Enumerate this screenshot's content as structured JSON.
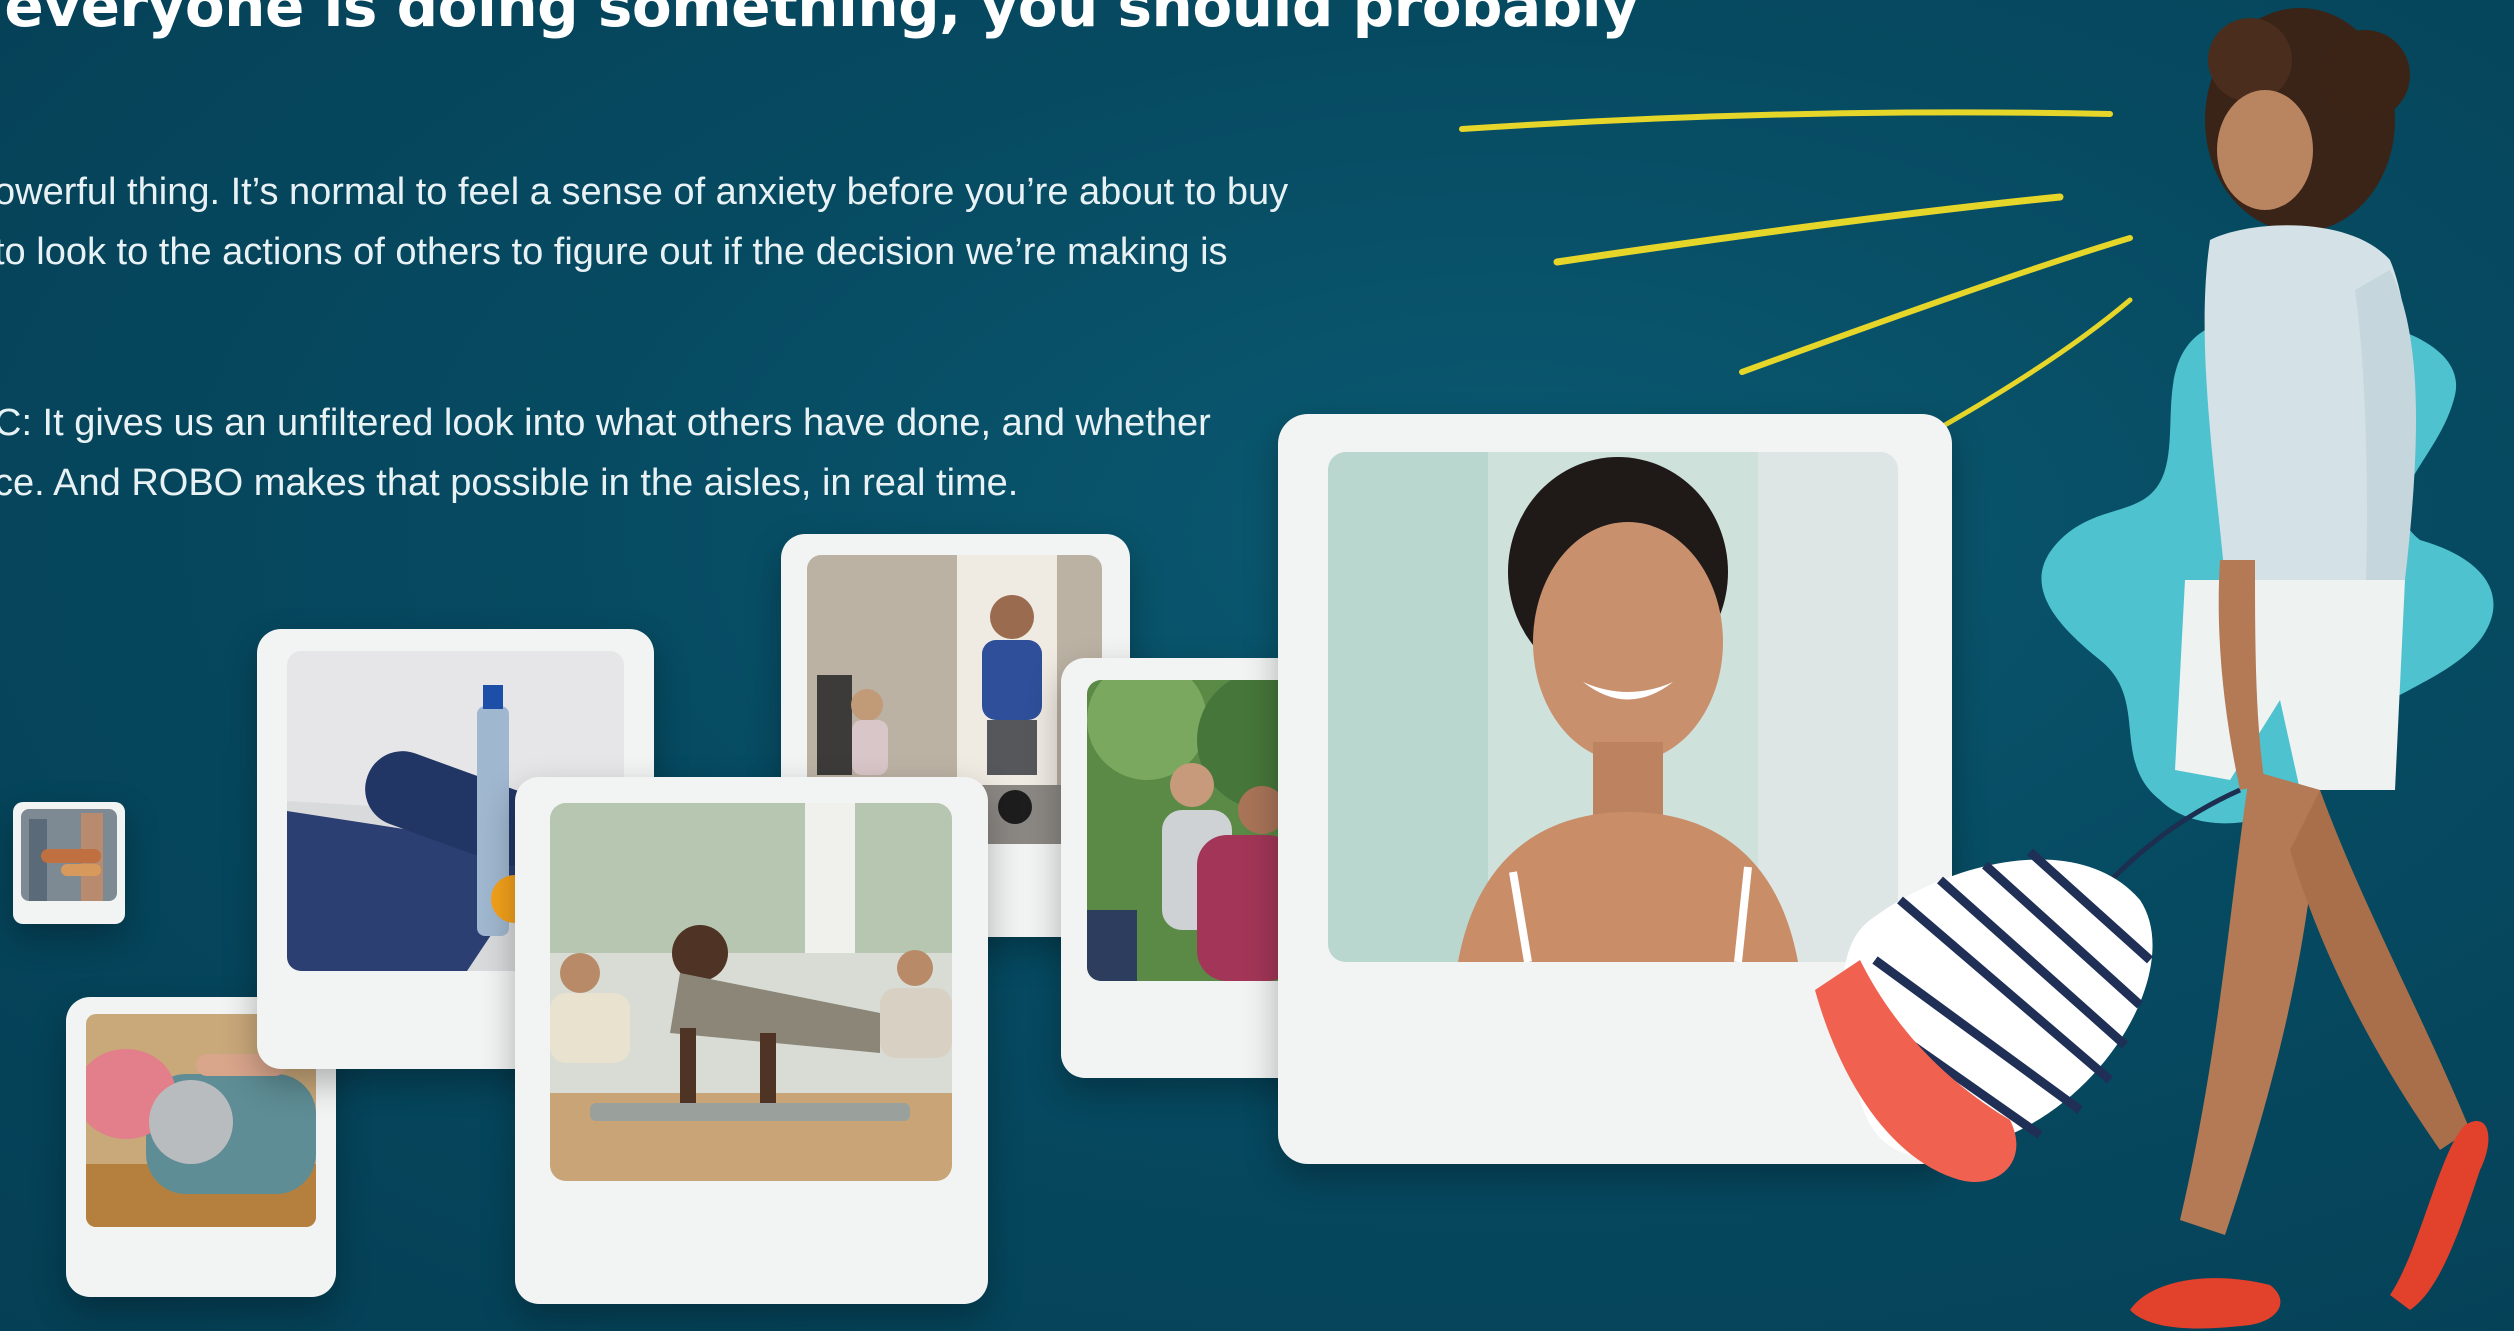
{
  "headline": "f everyone is doing something, you should probably",
  "paragraph_1": {
    "line_1": "owerful thing. It’s normal to feel a sense of anxiety before you’re about to buy",
    "line_2": "to look to the actions of others to figure out if the decision we’re making is"
  },
  "paragraph_2": {
    "line_1": "C: It gives us an unfiltered look into what others have done, and whether",
    "line_2": "ce. And ROBO makes that possible in the aisles, in real time."
  },
  "cards": [
    {
      "subject": "people holding rolled yoga mats"
    },
    {
      "subject": "woman stretching on a mat"
    },
    {
      "subject": "yoga mat with water bottle and orange"
    },
    {
      "subject": "man doing push-ups in a fitness class"
    },
    {
      "subject": "father and daughter lifting kettlebells"
    },
    {
      "subject": "group of people jogging outdoors"
    },
    {
      "subject": "smiling woman portrait"
    }
  ],
  "figure": {
    "subject": "woman walking with striped tote bag"
  },
  "colors": {
    "background": "#064a61",
    "card": "#f2f3f3",
    "accent_yellow": "#e5d629",
    "blob": "#4fc2cf",
    "text": "#e8f1f4"
  }
}
